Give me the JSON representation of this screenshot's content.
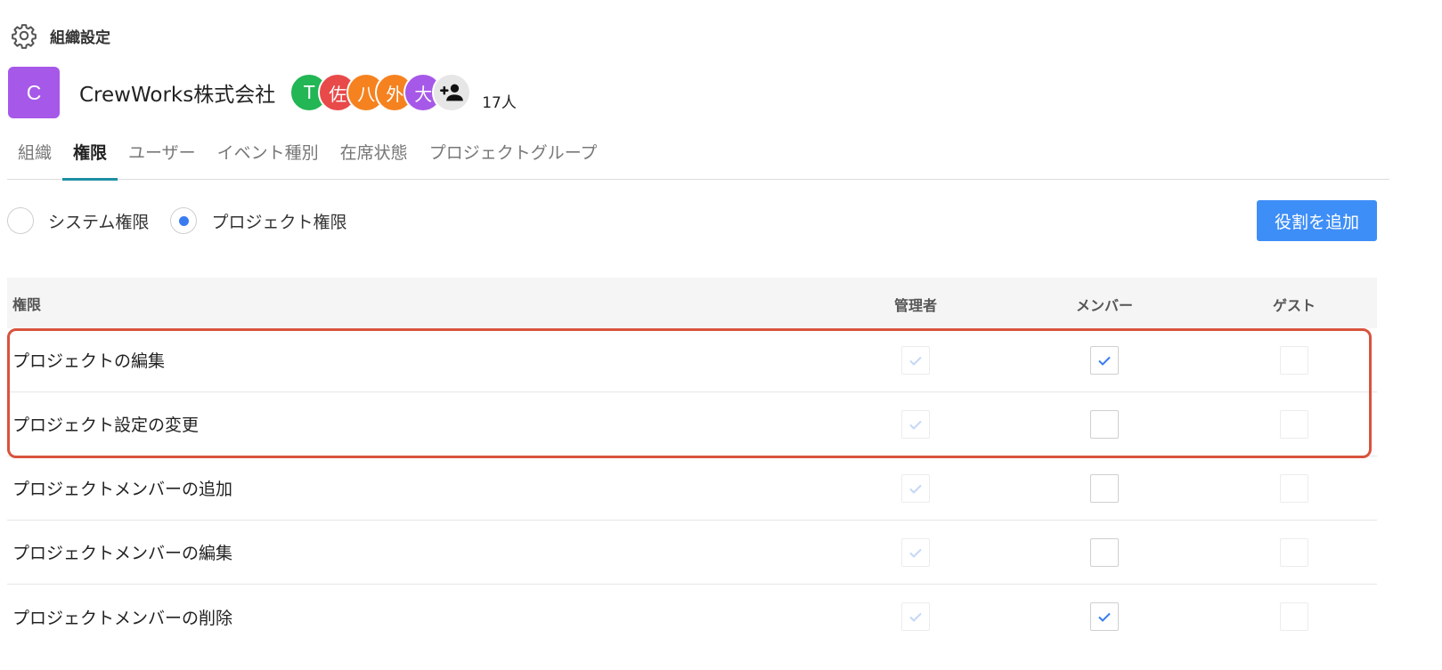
{
  "header": {
    "title": "組織設定",
    "icon": "gear-icon"
  },
  "organization": {
    "logo_letter": "C",
    "logo_color": "#a659e8",
    "name": "CrewWorks株式会社",
    "members": [
      {
        "initial": "T",
        "color": "#22b655"
      },
      {
        "initial": "佐",
        "color": "#e84a4a"
      },
      {
        "initial": "八",
        "color": "#f5821f"
      },
      {
        "initial": "外",
        "color": "#f5821f"
      },
      {
        "initial": "大",
        "color": "#a659e8"
      }
    ],
    "add_member_icon": "person-add-icon",
    "member_count": "17人"
  },
  "tabs": [
    {
      "label": "組織",
      "active": false
    },
    {
      "label": "権限",
      "active": true
    },
    {
      "label": "ユーザー",
      "active": false
    },
    {
      "label": "イベント種別",
      "active": false
    },
    {
      "label": "在席状態",
      "active": false
    },
    {
      "label": "プロジェクトグループ",
      "active": false
    }
  ],
  "permission_type": {
    "options": [
      {
        "label": "システム権限",
        "selected": false
      },
      {
        "label": "プロジェクト権限",
        "selected": true
      }
    ]
  },
  "add_role_button": "役割を追加",
  "table": {
    "headers": {
      "permission": "権限",
      "admin": "管理者",
      "member": "メンバー",
      "guest": "ゲスト"
    },
    "rows": [
      {
        "label": "プロジェクトの編集",
        "admin": true,
        "member": true,
        "guest": false
      },
      {
        "label": "プロジェクト設定の変更",
        "admin": true,
        "member": false,
        "guest": false
      },
      {
        "label": "プロジェクトメンバーの追加",
        "admin": true,
        "member": false,
        "guest": false
      },
      {
        "label": "プロジェクトメンバーの編集",
        "admin": true,
        "member": false,
        "guest": false
      },
      {
        "label": "プロジェクトメンバーの削除",
        "admin": true,
        "member": true,
        "guest": false
      }
    ]
  },
  "colors": {
    "accent": "#3e8ef7",
    "tab_indicator": "#1f8fa5",
    "highlight": "#d9533e",
    "check_active": "#3a7cf0",
    "check_disabled": "#c4d8f5"
  }
}
